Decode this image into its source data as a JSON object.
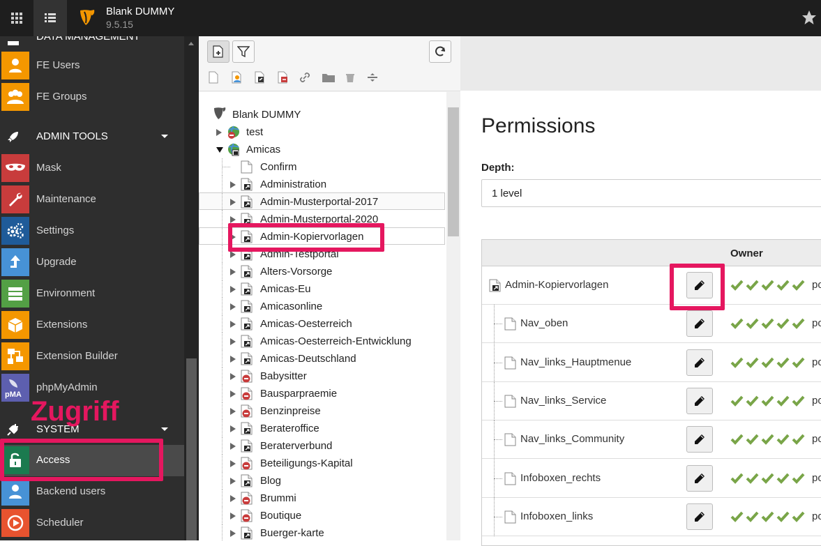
{
  "topbar": {
    "site_name": "Blank DUMMY",
    "version": "9.5.15",
    "icons": [
      "app-grid-icon",
      "list-icon",
      "typo3-logo",
      "star-icon"
    ]
  },
  "sidebar": {
    "partial_group": "DATA MANAGEMENT",
    "items_top": [
      {
        "label": "FE Users",
        "color": "#f49700"
      },
      {
        "label": "FE Groups",
        "color": "#f49700"
      }
    ],
    "admin_group": "ADMIN TOOLS",
    "admin_items": [
      {
        "label": "Mask",
        "color": "#c83c3c"
      },
      {
        "label": "Maintenance",
        "color": "#c83c3c"
      },
      {
        "label": "Settings",
        "color": "#1f5b99"
      },
      {
        "label": "Upgrade",
        "color": "#4792d6"
      },
      {
        "label": "Environment",
        "color": "#53a045"
      },
      {
        "label": "Extensions",
        "color": "#f49700"
      },
      {
        "label": "Extension Builder",
        "color": "#f49700"
      },
      {
        "label": "phpMyAdmin",
        "color": "#5d5faf"
      }
    ],
    "system_group": "SYSTEM",
    "system_items": [
      {
        "label": "Access",
        "color": "#1b7a4f",
        "active": true
      },
      {
        "label": "Backend users",
        "color": "#4792d6"
      },
      {
        "label": "Scheduler",
        "color": "#e8532f"
      }
    ]
  },
  "annotation": "Zugriff",
  "tree": {
    "root": "Blank DUMMY",
    "nodes": [
      {
        "label": "test",
        "level": 1,
        "expander": "closed",
        "icon": "globe-disabled"
      },
      {
        "label": "Amicas",
        "level": 1,
        "expander": "open",
        "icon": "globe-shortcut"
      },
      {
        "label": "Confirm",
        "level": 2,
        "expander": "none",
        "icon": "page"
      },
      {
        "label": "Administration",
        "level": 2,
        "expander": "closed",
        "icon": "shortcut"
      },
      {
        "label": "Admin-Musterportal-2017",
        "level": 2,
        "expander": "closed",
        "icon": "shortcut"
      },
      {
        "label": "Admin-Musterportal-2020",
        "level": 2,
        "expander": "closed",
        "icon": "shortcut"
      },
      {
        "label": "Admin-Kopiervorlagen",
        "level": 2,
        "expander": "closed",
        "icon": "shortcut",
        "selected": true
      },
      {
        "label": "Admin-Testportal",
        "level": 2,
        "expander": "closed",
        "icon": "shortcut"
      },
      {
        "label": "Alters-Vorsorge",
        "level": 2,
        "expander": "closed",
        "icon": "shortcut"
      },
      {
        "label": "Amicas-Eu",
        "level": 2,
        "expander": "closed",
        "icon": "shortcut"
      },
      {
        "label": "Amicasonline",
        "level": 2,
        "expander": "closed",
        "icon": "shortcut"
      },
      {
        "label": "Amicas-Oesterreich",
        "level": 2,
        "expander": "closed",
        "icon": "shortcut"
      },
      {
        "label": "Amicas-Oesterreich-Entwicklung",
        "level": 2,
        "expander": "closed",
        "icon": "shortcut"
      },
      {
        "label": "Amicas-Deutschland",
        "level": 2,
        "expander": "closed",
        "icon": "shortcut"
      },
      {
        "label": "Babysitter",
        "level": 2,
        "expander": "closed",
        "icon": "disabled"
      },
      {
        "label": "Bausparpraemie",
        "level": 2,
        "expander": "closed",
        "icon": "disabled"
      },
      {
        "label": "Benzinpreise",
        "level": 2,
        "expander": "closed",
        "icon": "disabled"
      },
      {
        "label": "Berateroffice",
        "level": 2,
        "expander": "closed",
        "icon": "shortcut"
      },
      {
        "label": "Beraterverbund",
        "level": 2,
        "expander": "closed",
        "icon": "shortcut"
      },
      {
        "label": "Beteiligungs-Kapital",
        "level": 2,
        "expander": "closed",
        "icon": "disabled"
      },
      {
        "label": "Blog",
        "level": 2,
        "expander": "closed",
        "icon": "shortcut"
      },
      {
        "label": "Brummi",
        "level": 2,
        "expander": "closed",
        "icon": "disabled"
      },
      {
        "label": "Boutique",
        "level": 2,
        "expander": "closed",
        "icon": "disabled"
      },
      {
        "label": "Buerger-karte",
        "level": 2,
        "expander": "closed",
        "icon": "shortcut"
      }
    ]
  },
  "main": {
    "title": "Permissions",
    "depth_label": "Depth:",
    "depth_value": "1 level",
    "owner_header": "Owner",
    "rows": [
      {
        "name": "Admin-Kopiervorlagen",
        "icon": "shortcut",
        "child": false,
        "owner_suffix": "po"
      },
      {
        "name": "Nav_oben",
        "icon": "page",
        "child": true,
        "owner_suffix": "po"
      },
      {
        "name": "Nav_links_Hauptmenue",
        "icon": "page",
        "child": true,
        "owner_suffix": "po"
      },
      {
        "name": "Nav_links_Service",
        "icon": "page",
        "child": true,
        "owner_suffix": "po"
      },
      {
        "name": "Nav_links_Community",
        "icon": "page",
        "child": true,
        "owner_suffix": "po"
      },
      {
        "name": "Infoboxen_rechts",
        "icon": "page",
        "child": true,
        "owner_suffix": "po"
      },
      {
        "name": "Infoboxen_links",
        "icon": "page",
        "child": true,
        "owner_suffix": "po"
      }
    ],
    "check_color": "#79a548",
    "marker_color": "#e5175f"
  }
}
